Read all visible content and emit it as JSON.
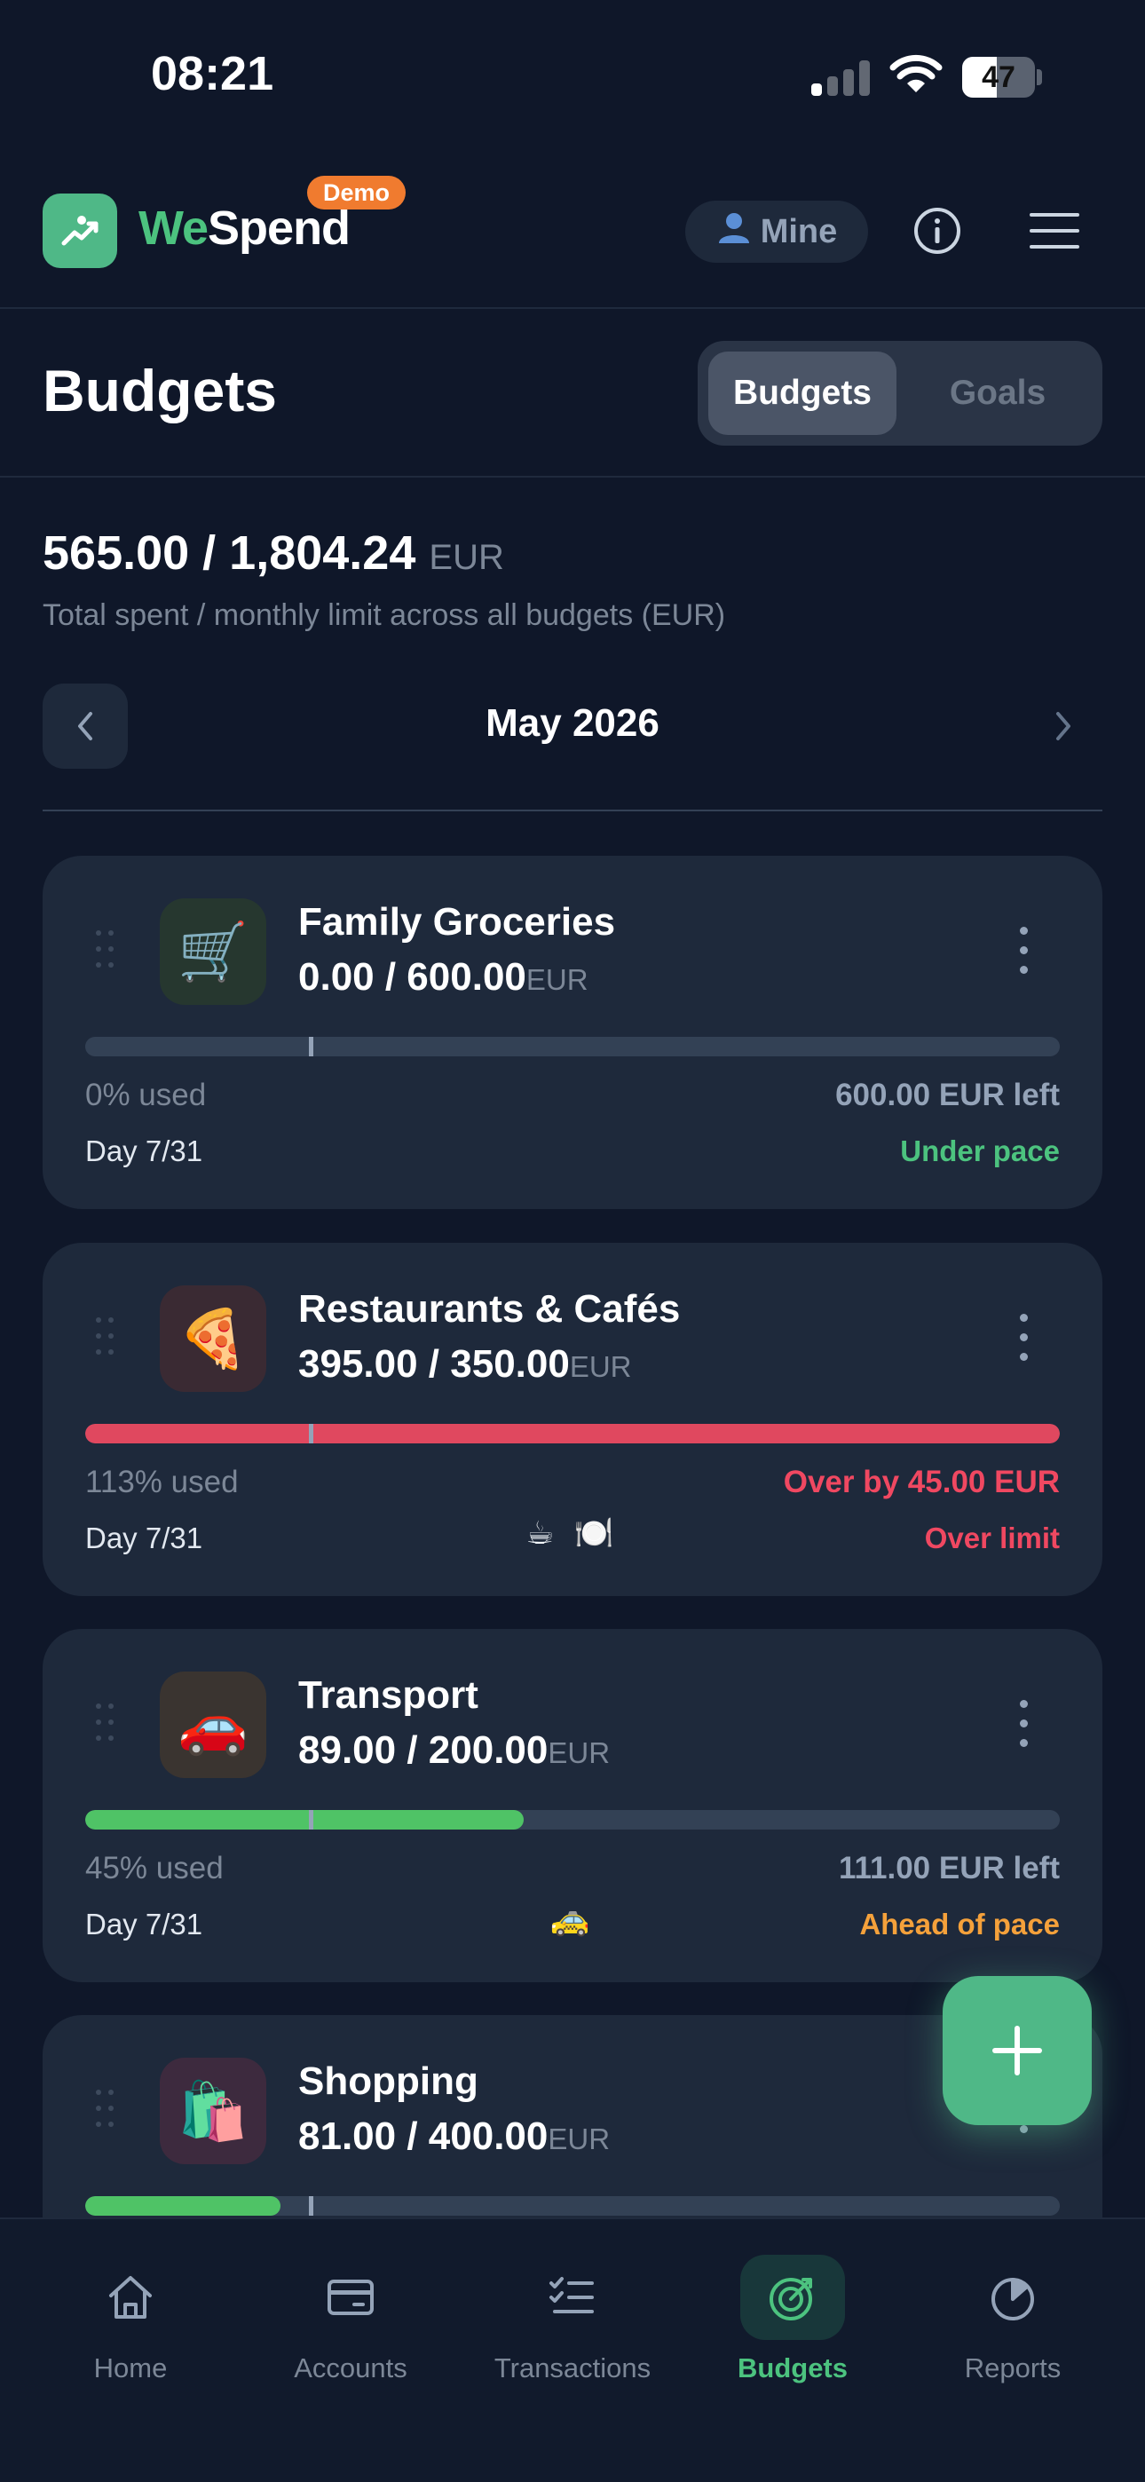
{
  "status_bar": {
    "time": "08:21",
    "battery": "47",
    "battery_level": 0.47
  },
  "header": {
    "brand_we": "We",
    "brand_spend": "Spend",
    "demo_badge": "Demo",
    "scope_pill": "Mine",
    "icons": {
      "logo": "trend-chart-icon",
      "scope": "person-icon",
      "info": "info-icon",
      "menu": "hamburger-menu-icon"
    }
  },
  "page": {
    "title": "Budgets",
    "segments": [
      "Budgets",
      "Goals"
    ],
    "active_segment": "Budgets"
  },
  "totals": {
    "amount": "565.00 / 1,804.24",
    "currency": "EUR",
    "subtitle": "Total spent / monthly limit across all budgets (EUR)"
  },
  "month": {
    "label": "May 2026"
  },
  "budgets": [
    {
      "name": "Family Groceries",
      "emoji": "🛒",
      "icon_bg": "#26372f",
      "amount": "0.00 / 600.00",
      "currency": "EUR",
      "progress": 0.0,
      "bar_color": "#334155",
      "used": "0% used",
      "remaining": "600.00 EUR left",
      "remaining_color": "#94a3b8",
      "day": "Day 7/31",
      "tags": "",
      "status": "Under pace",
      "status_color": "#4cc37f"
    },
    {
      "name": "Restaurants & Cafés",
      "emoji": "🍕",
      "icon_bg": "#3a2a33",
      "amount": "395.00 / 350.00",
      "currency": "EUR",
      "progress": 1.0,
      "bar_color": "#e0485f",
      "used": "113% used",
      "remaining": "Over by 45.00 EUR",
      "remaining_color": "#f04861",
      "day": "Day 7/31",
      "tags": "☕ 🍽️",
      "status": "Over limit",
      "status_color": "#f04861"
    },
    {
      "name": "Transport",
      "emoji": "🚗",
      "icon_bg": "#3a3430",
      "amount": "89.00 / 200.00",
      "currency": "EUR",
      "progress": 0.45,
      "bar_color": "#4fc366",
      "used": "45% used",
      "remaining": "111.00 EUR left",
      "remaining_color": "#94a3b8",
      "day": "Day 7/31",
      "tags": "🚕",
      "status": "Ahead of pace",
      "status_color": "#f5a13b"
    },
    {
      "name": "Shopping",
      "emoji": "🛍️",
      "icon_bg": "#3d2a3e",
      "amount": "81.00 / 400.00",
      "currency": "EUR",
      "progress": 0.2,
      "bar_color": "#4fc366",
      "used": "",
      "remaining": "",
      "remaining_color": "#94a3b8",
      "day": "",
      "tags": "",
      "status": "",
      "status_color": "#94a3b8"
    }
  ],
  "nav": [
    {
      "label": "Home",
      "icon": "home-icon",
      "active": false
    },
    {
      "label": "Accounts",
      "icon": "credit-card-icon",
      "active": false
    },
    {
      "label": "Transactions",
      "icon": "checklist-icon",
      "active": false
    },
    {
      "label": "Budgets",
      "icon": "target-icon",
      "active": true
    },
    {
      "label": "Reports",
      "icon": "pie-chart-icon",
      "active": false
    }
  ],
  "fab": {
    "icon": "plus-icon"
  }
}
